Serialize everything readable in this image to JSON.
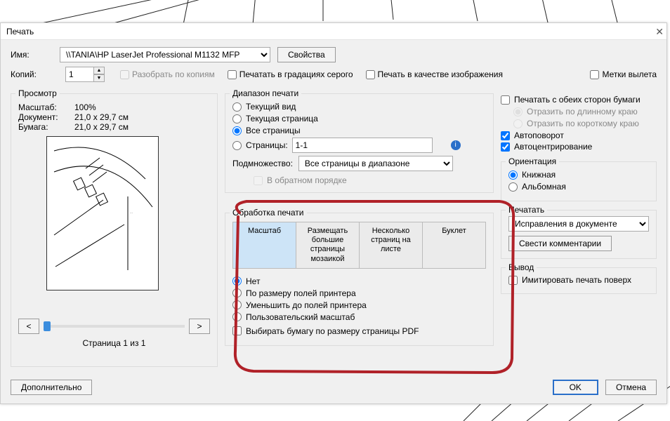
{
  "title": "Печать",
  "name_label": "Имя:",
  "printer": "\\\\TANIA\\HP LaserJet Professional M1132 MFP",
  "properties_btn": "Свойства",
  "copies_label": "Копий:",
  "copies_value": "1",
  "collate": "Разобрать по копиям",
  "grayscale": "Печатать в градациях серого",
  "as_image": "Печать в качестве изображения",
  "crop_marks": "Метки вылета",
  "preview_group": "Просмотр",
  "scale_k": "Масштаб:",
  "scale_v": "100%",
  "doc_k": "Документ:",
  "doc_v": "21,0 x 29,7 см",
  "paper_k": "Бумага:",
  "paper_v": "21,0 x 29,7 см",
  "page_counter": "Страница 1 из 1",
  "range_group": "Диапазон печати",
  "r_current_view": "Текущий вид",
  "r_current_page": "Текущая страница",
  "r_all": "Все страницы",
  "r_pages": "Страницы:",
  "pages_val": "1-1",
  "subset_label": "Подмножество:",
  "subset_val": "Все страницы в диапазоне",
  "reverse": "В обратном порядке",
  "process_group": "Обработка печати",
  "tab_scale": "Масштаб",
  "tab_tile": "Размещать большие страницы мозаикой",
  "tab_multi": "Несколько страниц на листе",
  "tab_book": "Буклет",
  "s_none": "Нет",
  "s_fit_margins": "По размеру полей принтера",
  "s_shrink": "Уменьшить до полей принтера",
  "s_custom": "Пользовательский масштаб",
  "s_choose": "Выбирать бумагу по размеру страницы PDF",
  "duplex": "Печатать с обеих сторон бумаги",
  "flip_long": "Отразить по длинному краю",
  "flip_short": "Отразить по короткому краю",
  "autorotate": "Автоповорот",
  "autocenter": "Автоцентрирование",
  "orient_group": "Ориентация",
  "portrait": "Книжная",
  "landscape": "Альбомная",
  "print_group": "Печатать",
  "print_what": "Исправления в документе",
  "summarize": "Свести комментарии",
  "output_group": "Вывод",
  "simulate": "Имитировать печать поверх",
  "advanced": "Дополнительно",
  "ok": "OK",
  "cancel": "Отмена"
}
